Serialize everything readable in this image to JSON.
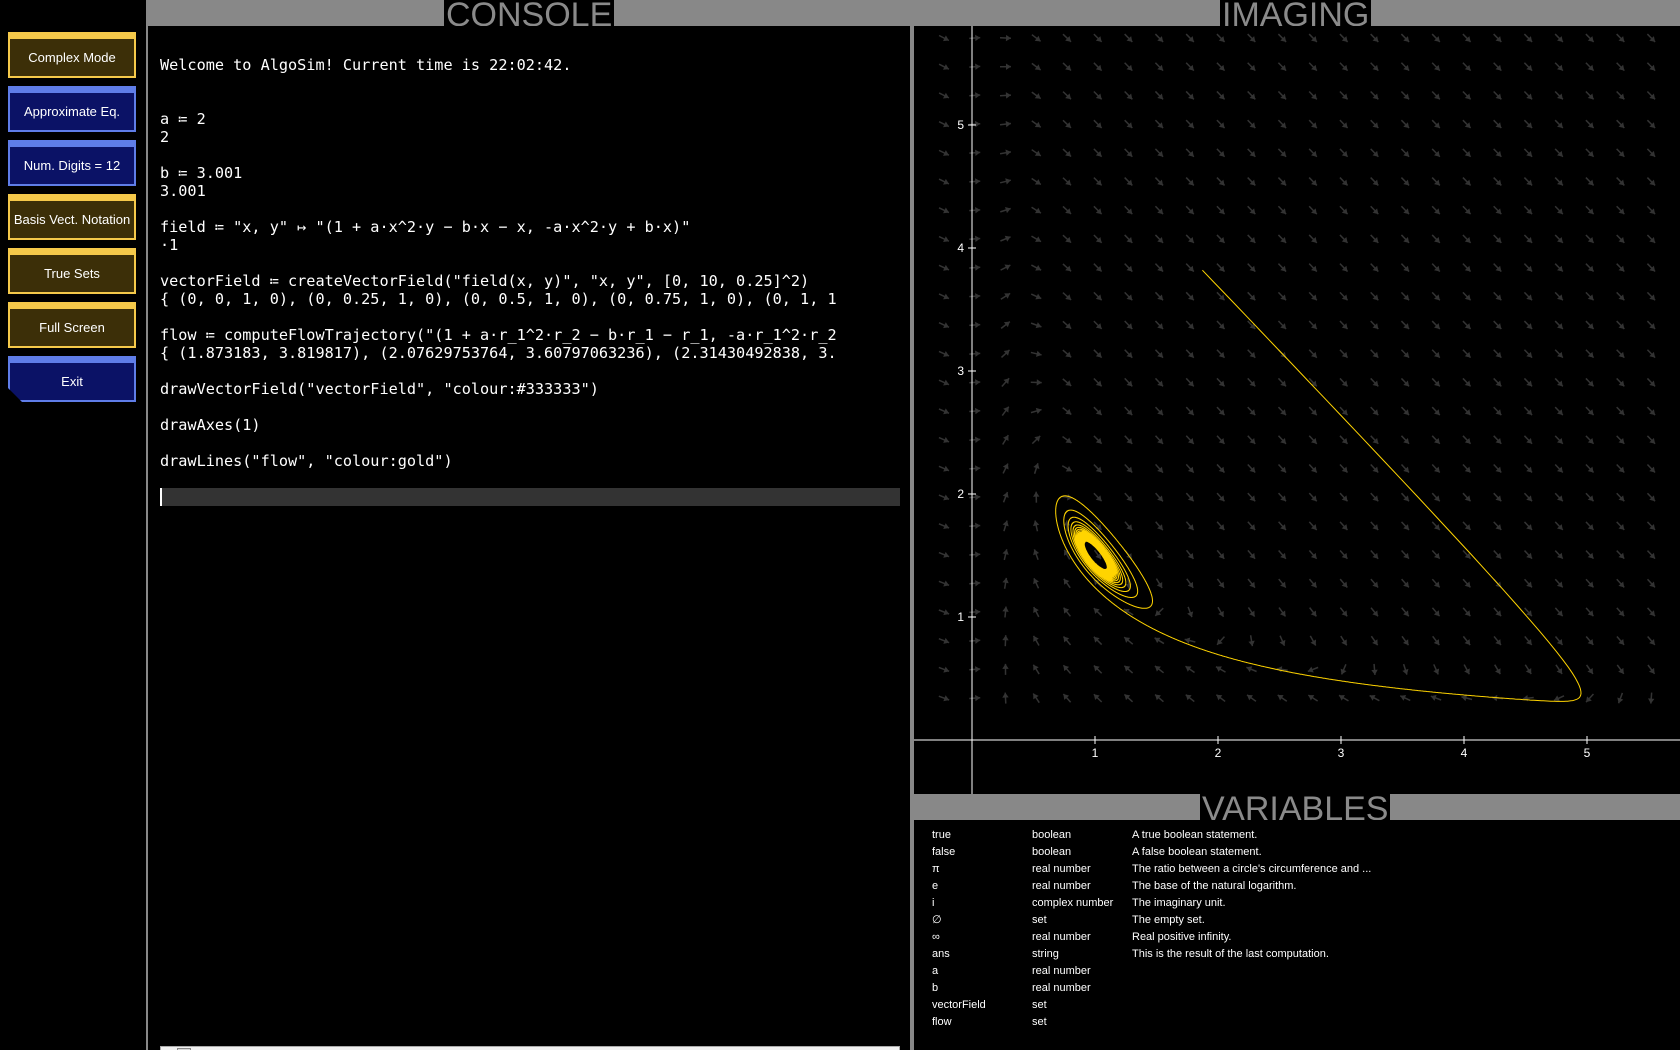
{
  "sections": {
    "console": "CONSOLE",
    "imaging": "IMAGING",
    "variables": "VARIABLES"
  },
  "sidebar": {
    "buttons": [
      {
        "label": "Complex Mode",
        "style": "gold"
      },
      {
        "label": "Approximate Eq.",
        "style": "blue"
      },
      {
        "label": "Num. Digits = 12",
        "style": "blue"
      },
      {
        "label": "Basis Vect. Notation",
        "style": "gold"
      },
      {
        "label": "True Sets",
        "style": "gold"
      },
      {
        "label": "Full Screen",
        "style": "gold"
      },
      {
        "label": "Exit",
        "style": "blue"
      }
    ]
  },
  "console": {
    "lines": [
      "Welcome to AlgoSim! Current time is 22:02:42.",
      "a ≔ 2",
      "2",
      "b ≔ 3.001",
      "3.001",
      "field ≔ \"x, y\" ↦ \"(1 + a·x^2·y − b·x − x, -a·x^2·y + b·x)\"",
      "·1",
      "vectorField ≔ createVectorField(\"field(x, y)\", \"x, y\", [0, 10, 0.25]^2)",
      "{ (0, 0, 1, 0), (0, 0.25, 1, 0), (0, 0.5, 1, 0), (0, 0.75, 1, 0), (0, 1, 1",
      "flow ≔ computeFlowTrajectory(\"(1 + a·r_1^2·r_2 − b·r_1 − r_1, -a·r_1^2·r_2",
      "{ (1.873183, 3.819817), (2.07629753764, 3.60797063236), (2.31430492838, 3.",
      "drawVectorField(\"vectorField\", \"colour:#333333\")",
      "drawAxes(1)",
      "drawLines(\"flow\", \"colour:gold\")"
    ],
    "input_value": ""
  },
  "imaging": {
    "x_ticks": [
      "1",
      "2",
      "3",
      "4",
      "5"
    ],
    "y_ticks": [
      "1",
      "2",
      "3",
      "4",
      "5"
    ],
    "field_colour": "#333333",
    "trajectory_colour": "#ffd400",
    "a": 2,
    "b": 3.001,
    "trajectory_start": [
      1.873183,
      3.819817
    ]
  },
  "variables": {
    "rows": [
      {
        "name": "true",
        "type": "boolean",
        "desc": "A true boolean statement."
      },
      {
        "name": "false",
        "type": "boolean",
        "desc": "A false boolean statement."
      },
      {
        "name": "π",
        "type": "real number",
        "desc": "The ratio between a circle's circumference and ..."
      },
      {
        "name": "e",
        "type": "real number",
        "desc": "The base of the natural logarithm."
      },
      {
        "name": "i",
        "type": "complex number",
        "desc": "The imaginary unit."
      },
      {
        "name": "∅",
        "type": "set",
        "desc": "The empty set."
      },
      {
        "name": "∞",
        "type": "real number",
        "desc": "Real positive infinity."
      },
      {
        "name": "ans",
        "type": "string",
        "desc": "This is the result of the last computation."
      },
      {
        "name": "a",
        "type": "real number",
        "desc": ""
      },
      {
        "name": "b",
        "type": "real number",
        "desc": ""
      },
      {
        "name": "vectorField",
        "type": "set",
        "desc": ""
      },
      {
        "name": "flow",
        "type": "set",
        "desc": ""
      }
    ]
  }
}
